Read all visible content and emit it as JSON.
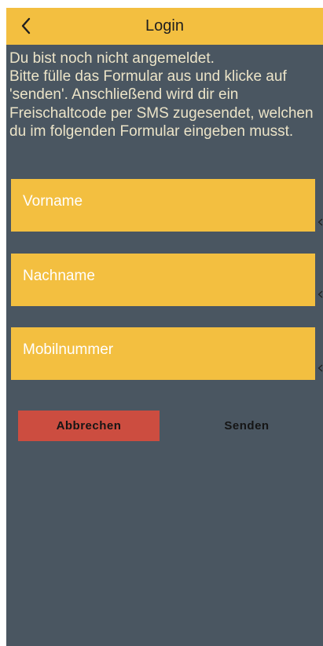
{
  "header": {
    "title": "Login",
    "back_icon": "chevron-left-icon"
  },
  "intro": {
    "text": "Du bist noch nicht angemeldet.\nBitte fülle das Formular aus und klicke auf 'senden'. Anschließend wird dir ein Freischaltcode per SMS zugesendet, welchen du im folgenden Formular eingeben musst."
  },
  "form": {
    "first_name": {
      "placeholder": "Vorname",
      "value": ""
    },
    "last_name": {
      "placeholder": "Nachname",
      "value": ""
    },
    "mobile": {
      "placeholder": "Mobilnummer",
      "value": ""
    }
  },
  "actions": {
    "cancel_label": "Abbrechen",
    "send_label": "Senden"
  },
  "colors": {
    "accent": "#f3bf40",
    "background": "#4a5661",
    "cancel": "#cc4d40",
    "intro_text": "#ece4c8"
  }
}
